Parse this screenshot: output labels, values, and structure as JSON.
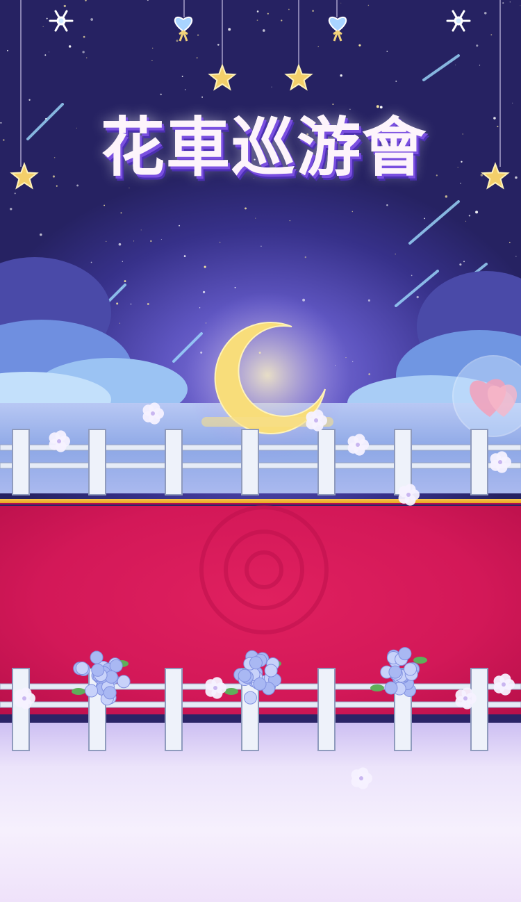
{
  "banner": {
    "title": "花車巡游會"
  },
  "colors": {
    "sky_top": "#262262",
    "carpet": "#d31858",
    "gold_trim": "#f6c74a",
    "floor": "#ece4fb"
  },
  "icons": [
    "snowflake-icon",
    "heart-ornament-icon",
    "star-ornament-icon",
    "crescent-moon-icon",
    "heart-balloon-icon",
    "hydrangea-icon",
    "blossom-icon"
  ]
}
